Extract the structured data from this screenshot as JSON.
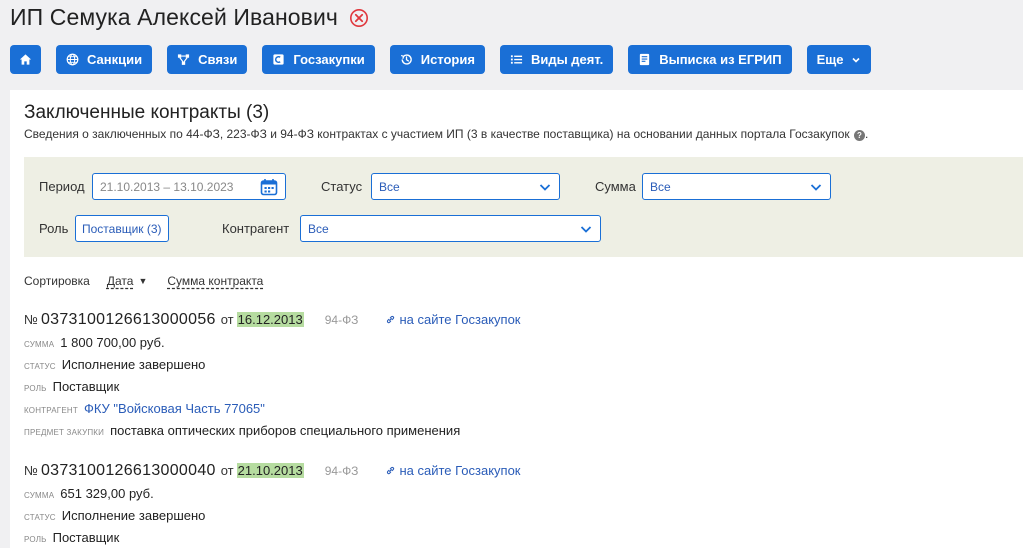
{
  "header": {
    "title": "ИП Семука Алексей Иванович",
    "close_icon": "close-circle-icon",
    "close_color": "#e0383e"
  },
  "toolbar": {
    "accent": "#1a6fd6",
    "home_icon": "home-icon",
    "buttons": [
      {
        "label": "Санкции",
        "icon": "globe-icon"
      },
      {
        "label": "Связи",
        "icon": "network-icon"
      },
      {
        "label": "Госзакупки",
        "icon": "procurement-icon"
      },
      {
        "label": "История",
        "icon": "history-icon"
      },
      {
        "label": "Виды деят.",
        "icon": "list-icon"
      },
      {
        "label": "Выписка из ЕГРИП",
        "icon": "document-icon"
      }
    ],
    "more_label": "Еще"
  },
  "section": {
    "title": "Заключенные контракты (3)",
    "description": "Сведения о заключенных по 44-ФЗ, 223-ФЗ и 94-ФЗ контрактах с участием ИП (3 в качестве поставщика) на основании данных портала Госзакупок",
    "description_end": "."
  },
  "filters": {
    "period_label": "Период",
    "period_value": "21.10.2013 – 13.10.2023",
    "status_label": "Статус",
    "status_value": "Все",
    "sum_label": "Сумма",
    "sum_value": "Все",
    "role_label": "Роль",
    "role_value": "Поставщик (3)",
    "counterparty_label": "Контрагент",
    "counterparty_value": "Все"
  },
  "sort": {
    "label": "Сортировка",
    "date": "Дата",
    "date_arrow": "▼",
    "amount": "Сумма контракта"
  },
  "contract_labels": {
    "num_prefix": "№",
    "from": "от",
    "sum": "СУММА",
    "status": "СТАТУС",
    "role": "РОЛЬ",
    "counterparty": "КОНТРАГЕНТ",
    "subject": "ПРЕДМЕТ ЗАКУПКИ",
    "link": "на сайте Госзакупок"
  },
  "contracts": [
    {
      "number": "0373100126613000056",
      "date": "16.12.2013",
      "law": "94-ФЗ",
      "sum": "1 800 700,00 руб.",
      "status": "Исполнение завершено",
      "role": "Поставщик",
      "counterparty": "ФКУ \"Войсковая Часть 77065\"",
      "subject": "поставка оптических приборов специального применения"
    },
    {
      "number": "0373100126613000040",
      "date": "21.10.2013",
      "law": "94-ФЗ",
      "sum": "651 329,00 руб.",
      "status": "Исполнение завершено",
      "role": "Поставщик"
    }
  ]
}
